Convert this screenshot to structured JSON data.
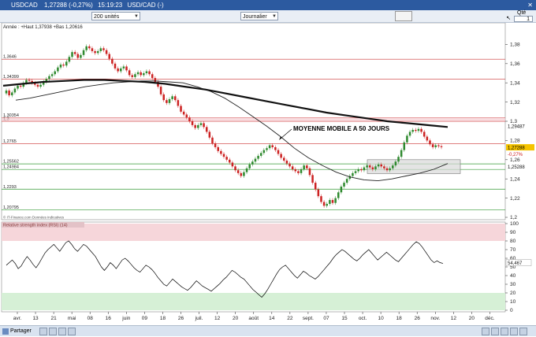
{
  "window": {
    "title": "USDCAD",
    "price": "1,27288",
    "change": "(-0,27%)",
    "time": "15:19:23",
    "symbol_name": "USD/CAD (-)"
  },
  "toolbar": {
    "units": "200 unités",
    "period": "Journalier",
    "qty_label": "Qté",
    "qty_value": "1"
  },
  "bottom": {
    "share_label": "Partager"
  },
  "colors": {
    "titlebar": "#2c5aa0",
    "candle_up": "#2f8a2f",
    "candle_down": "#cc2222",
    "ma_thin": "#222222",
    "ma_thick": "#111111",
    "support": "#339933",
    "resistance": "#cc3333"
  },
  "chart_data": [
    {
      "type": "candlestick",
      "header": "Année : +Haut 1,37938 +Bas 1,20616",
      "source": "© IT-Finance.com Données indicatives",
      "annotation": "MOYENNE MOBILE A 50 JOURS",
      "ylim": [
        1.2,
        1.4
      ],
      "y_ticks": [
        "1,38",
        "1,36",
        "1,34",
        "1,32",
        "1,3",
        "1,28",
        "1,26",
        "1,24",
        "1,22",
        "1,2"
      ],
      "x_ticks": [
        "avr.",
        "13",
        "21",
        "mai",
        "08",
        "16",
        "juin",
        "09",
        "18",
        "26",
        "juil.",
        "12",
        "20",
        "août",
        "14",
        "22",
        "sept.",
        "07",
        "15",
        "oct.",
        "10",
        "18",
        "26",
        "nov.",
        "12",
        "20",
        "déc."
      ],
      "last_price_label": "1,27288",
      "last_change_label": "-0,27%",
      "marker_label": "1,29487",
      "horizontal_levels": [
        {
          "value": 1.3646,
          "label": "1,3646",
          "color": "resistance"
        },
        {
          "value": 1.34399,
          "label": "1,34399",
          "color": "resistance"
        },
        {
          "value": 1.30354,
          "label": "1,30354",
          "color": "resistance"
        },
        {
          "value": 1.3,
          "label": "1,3",
          "color": "resistance"
        },
        {
          "value": 1.2765,
          "label": "1,2765",
          "color": "resistance"
        },
        {
          "value": 1.25562,
          "label": "1,25562",
          "color": "support"
        },
        {
          "value": 1.24984,
          "label": "1,24984",
          "color": "support"
        },
        {
          "value": 1.2293,
          "label": "1,2293",
          "color": "support"
        },
        {
          "value": 1.20795,
          "label": "1,20795",
          "color": "support"
        }
      ],
      "close": [
        1.332,
        1.327,
        1.33,
        1.334,
        1.337,
        1.336,
        1.34,
        1.343,
        1.342,
        1.34,
        1.338,
        1.336,
        1.338,
        1.341,
        1.344,
        1.347,
        1.349,
        1.352,
        1.356,
        1.359,
        1.358,
        1.362,
        1.367,
        1.372,
        1.37,
        1.366,
        1.369,
        1.374,
        1.378,
        1.376,
        1.373,
        1.371,
        1.373,
        1.376,
        1.374,
        1.37,
        1.365,
        1.36,
        1.355,
        1.352,
        1.355,
        1.357,
        1.353,
        1.348,
        1.346,
        1.349,
        1.351,
        1.348,
        1.35,
        1.352,
        1.349,
        1.345,
        1.341,
        1.336,
        1.328,
        1.322,
        1.319,
        1.323,
        1.326,
        1.322,
        1.316,
        1.31,
        1.307,
        1.304,
        1.3,
        1.296,
        1.293,
        1.296,
        1.298,
        1.294,
        1.289,
        1.283,
        1.277,
        1.273,
        1.269,
        1.266,
        1.263,
        1.26,
        1.257,
        1.253,
        1.249,
        1.246,
        1.243,
        1.247,
        1.251,
        1.255,
        1.258,
        1.261,
        1.264,
        1.267,
        1.27,
        1.272,
        1.275,
        1.273,
        1.27,
        1.266,
        1.262,
        1.259,
        1.256,
        1.253,
        1.25,
        1.248,
        1.246,
        1.25,
        1.254,
        1.251,
        1.244,
        1.236,
        1.229,
        1.222,
        1.216,
        1.212,
        1.214,
        1.218,
        1.215,
        1.22,
        1.226,
        1.232,
        1.236,
        1.24,
        1.243,
        1.246,
        1.248,
        1.25,
        1.249,
        1.252,
        1.254,
        1.252,
        1.25,
        1.253,
        1.255,
        1.253,
        1.251,
        1.249,
        1.251,
        1.254,
        1.258,
        1.263,
        1.27,
        1.278,
        1.285,
        1.289,
        1.291,
        1.29,
        1.292,
        1.289,
        1.284,
        1.28,
        1.276,
        1.273,
        1.275,
        1.274,
        1.273
      ],
      "ma_short": [
        1.322,
        1.324,
        1.327,
        1.33,
        1.333,
        1.336,
        1.338,
        1.34,
        1.341,
        1.342,
        1.342,
        1.341,
        1.34,
        1.336,
        1.331,
        1.324,
        1.315,
        1.305,
        1.295,
        1.284,
        1.272,
        1.262,
        1.254,
        1.247,
        1.242,
        1.239,
        1.238,
        1.24,
        1.243,
        1.246,
        1.25,
        1.256
      ],
      "ma_long": [
        1.337,
        1.339,
        1.341,
        1.342,
        1.343,
        1.343,
        1.342,
        1.341,
        1.339,
        1.336,
        1.333,
        1.329,
        1.325,
        1.321,
        1.317,
        1.313,
        1.309,
        1.306,
        1.303,
        1.3,
        1.298,
        1.296,
        1.294
      ],
      "rsi": {
        "title": "Relative strength index (RSI) (14)",
        "ylim": [
          0,
          100
        ],
        "y_ticks": [
          "100",
          "90",
          "80",
          "70",
          "60",
          "50",
          "40",
          "30",
          "20",
          "10",
          "0"
        ],
        "last_label": "54,467",
        "overbought": 80,
        "oversold": 20,
        "values": [
          52,
          55,
          58,
          54,
          48,
          51,
          57,
          62,
          58,
          53,
          49,
          54,
          60,
          66,
          70,
          73,
          76,
          72,
          68,
          73,
          78,
          80,
          76,
          71,
          68,
          72,
          76,
          74,
          70,
          66,
          62,
          56,
          50,
          46,
          50,
          55,
          52,
          48,
          53,
          58,
          60,
          57,
          53,
          49,
          46,
          44,
          48,
          52,
          50,
          47,
          43,
          38,
          34,
          30,
          28,
          32,
          36,
          33,
          30,
          27,
          25,
          23,
          26,
          30,
          34,
          31,
          28,
          26,
          24,
          22,
          25,
          28,
          31,
          35,
          38,
          42,
          46,
          44,
          41,
          38,
          36,
          32,
          28,
          24,
          21,
          18,
          15,
          19,
          24,
          30,
          36,
          42,
          47,
          50,
          52,
          48,
          44,
          40,
          37,
          41,
          45,
          43,
          40,
          38,
          36,
          39,
          43,
          47,
          51,
          55,
          60,
          64,
          67,
          70,
          68,
          65,
          62,
          59,
          57,
          60,
          64,
          67,
          70,
          66,
          62,
          58,
          61,
          64,
          67,
          64,
          61,
          58,
          56,
          60,
          64,
          68,
          72,
          76,
          79,
          77,
          73,
          68,
          63,
          58,
          55,
          57,
          55,
          54
        ]
      }
    }
  ]
}
